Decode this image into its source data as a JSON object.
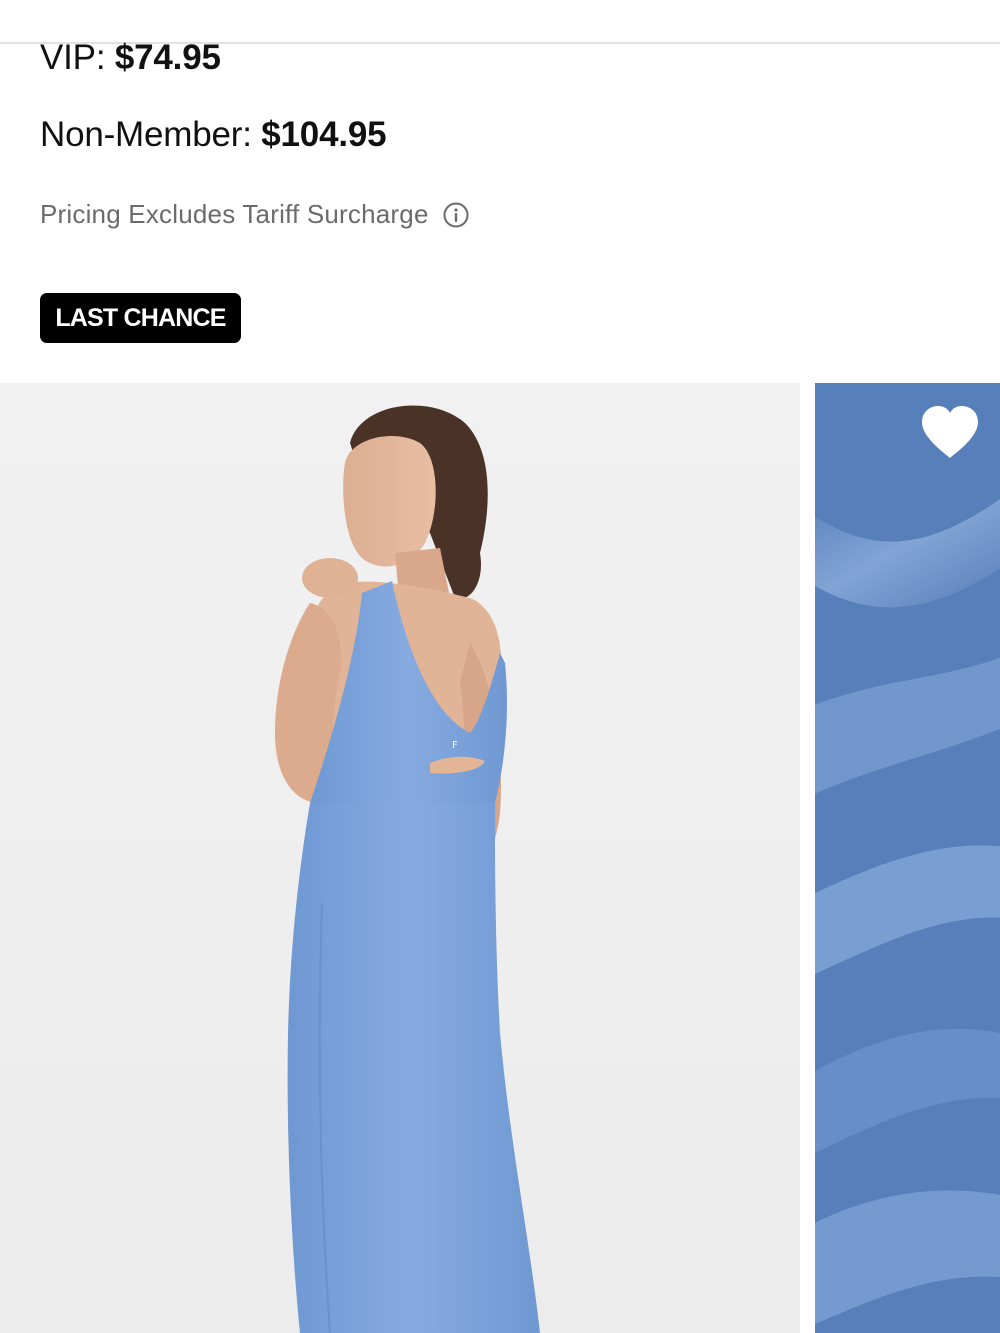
{
  "pricing": {
    "vip_label": "VIP:",
    "vip_price": "$74.95",
    "non_member_label": "Non-Member:",
    "non_member_price": "$104.95",
    "tariff_note": "Pricing Excludes Tariff Surcharge",
    "tariff_icon": "info-icon"
  },
  "badge": {
    "label": "LAST CHANCE"
  },
  "gallery": {
    "main_image": "product-photo-model-blue-dress-back",
    "secondary_image": "fabric-swatch-blue",
    "favorite_icon": "heart-icon"
  },
  "colors": {
    "badge_bg": "#000000",
    "dress_blue": "#7fa6dc",
    "swatch_blue": "#5b83bd",
    "muted_text": "#6b6b6b"
  }
}
